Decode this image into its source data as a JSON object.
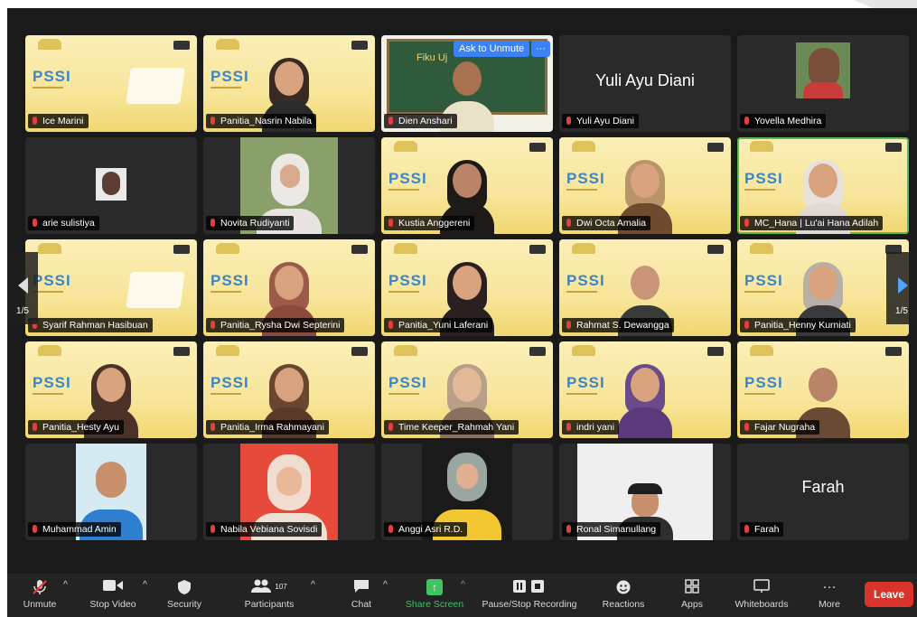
{
  "participants": [
    {
      "name": "Ice Marini"
    },
    {
      "name": "Panitia_Nasrin Nabila"
    },
    {
      "name": "Dien Anshari",
      "overlay": "Ask to Unmute",
      "overlay_more": "···",
      "slide_text": "Fiku Uj"
    },
    {
      "name": "Yuli Ayu Diani",
      "display_name": "Yuli Ayu Diani"
    },
    {
      "name": "Yovella Medhira"
    },
    {
      "name": "arie sulistiya"
    },
    {
      "name": "Novita Rudiyanti"
    },
    {
      "name": "Kustia Anggereni"
    },
    {
      "name": "Dwi Octa Amalia"
    },
    {
      "name": "MC_Hana | Lu'ai Hana Adilah"
    },
    {
      "name": "Syarif Rahman Hasibuan"
    },
    {
      "name": "Panitia_Rysha Dwi Septerini"
    },
    {
      "name": "Panitia_Yuni Laferani"
    },
    {
      "name": "Rahmat S. Dewangga"
    },
    {
      "name": "Panitia_Henny Kurniati"
    },
    {
      "name": "Panitia_Hesty Ayu"
    },
    {
      "name": "Panitia_Irma Rahmayani"
    },
    {
      "name": "Time Keeper_Rahmah Yani"
    },
    {
      "name": "indri yani"
    },
    {
      "name": "Fajar Nugraha"
    },
    {
      "name": "Muhammad Amin"
    },
    {
      "name": "Nabila Vebiana Sovisdi"
    },
    {
      "name": "Anggi Asri R.D."
    },
    {
      "name": "Ronal Simanullang"
    },
    {
      "name": "Farah",
      "display_name": "Farah"
    }
  ],
  "background_logo": "PSSI",
  "pagination": {
    "left": "1/5",
    "right": "1/5"
  },
  "toolbar": {
    "unmute": "Unmute",
    "stop_video": "Stop Video",
    "security": "Security",
    "participants": "Participants",
    "participant_count": "107",
    "chat": "Chat",
    "share_screen": "Share Screen",
    "recording": "Pause/Stop Recording",
    "reactions": "Reactions",
    "apps": "Apps",
    "whiteboards": "Whiteboards",
    "more": "More",
    "more_dots": "···",
    "leave": "Leave"
  },
  "colors": {
    "accent": "#3b82f6",
    "leave": "#d9342b",
    "share": "#40c463",
    "speaker_highlight": "#5cb85c"
  }
}
